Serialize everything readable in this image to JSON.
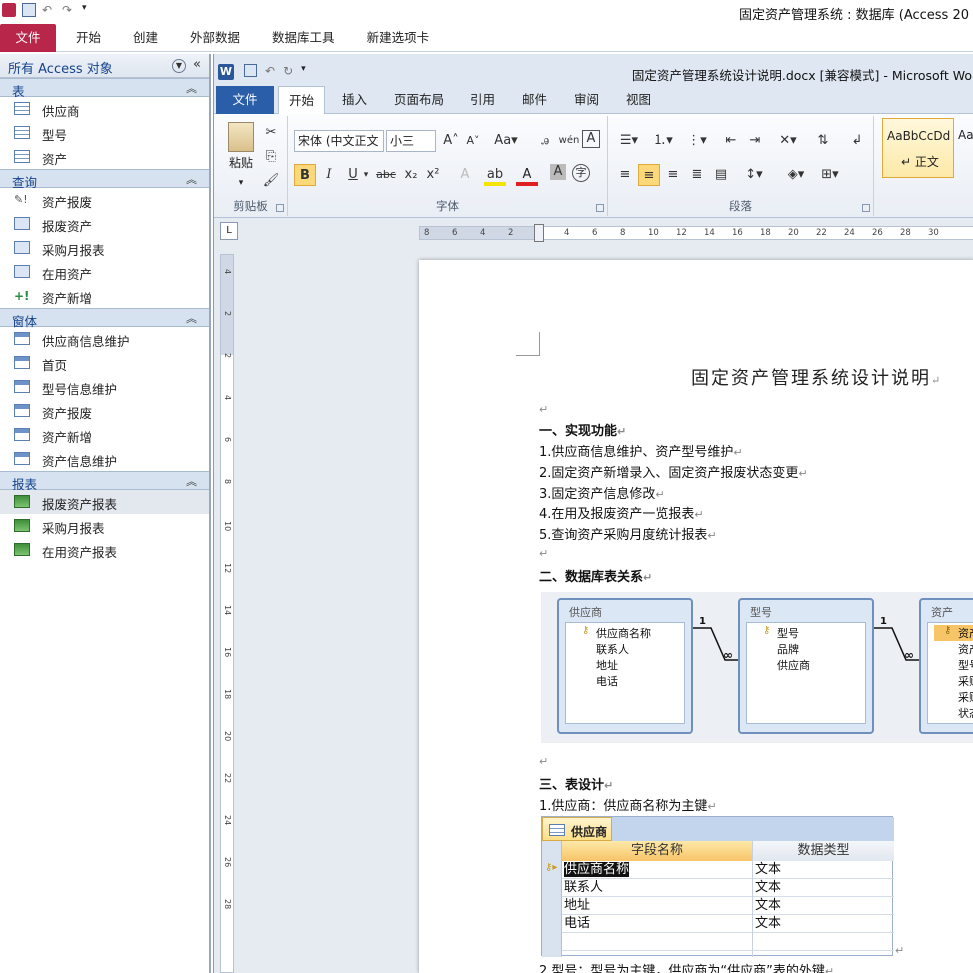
{
  "access": {
    "title": "固定资产管理系统 : 数据库 (Access 20",
    "tabs": [
      "文件",
      "开始",
      "创建",
      "外部数据",
      "数据库工具",
      "新建选项卡"
    ]
  },
  "nav": {
    "header": "所有 Access 对象",
    "groups": [
      {
        "title": "表",
        "items": [
          "供应商",
          "型号",
          "资产"
        ]
      },
      {
        "title": "查询",
        "items": [
          "资产报废",
          "报废资产",
          "采购月报表",
          "在用资产",
          "资产新增"
        ]
      },
      {
        "title": "窗体",
        "items": [
          "供应商信息维护",
          "首页",
          "型号信息维护",
          "资产报废",
          "资产新增",
          "资产信息维护"
        ]
      },
      {
        "title": "报表",
        "items": [
          "报废资产报表",
          "采购月报表",
          "在用资产报表"
        ]
      }
    ]
  },
  "word": {
    "doc_title": "固定资产管理系统设计说明.docx [兼容模式] - Microsoft Wo",
    "tabs": [
      "文件",
      "开始",
      "插入",
      "页面布局",
      "引用",
      "邮件",
      "审阅",
      "视图"
    ],
    "ribbon": {
      "paste_label": "粘贴",
      "font_name": "宋体 (中文正文",
      "font_size": "小三",
      "groups": {
        "clipboard": "剪贴板",
        "font": "字体",
        "paragraph": "段落"
      },
      "style_preview": "AaBbCcDd",
      "style_name": "↵ 正文",
      "style_preview2": "Aa"
    },
    "ruler_ticks": [
      "8",
      "6",
      "4",
      "2",
      "2",
      "4",
      "6",
      "8",
      "10",
      "12",
      "14",
      "16",
      "18",
      "20",
      "22",
      "24",
      "26",
      "28",
      "30"
    ],
    "vruler_ticks": [
      "4",
      "2",
      "2",
      "4",
      "6",
      "8",
      "10",
      "12",
      "14",
      "16",
      "18",
      "20",
      "22",
      "24",
      "26",
      "28"
    ]
  },
  "doc": {
    "title": "固定资产管理系统设计说明",
    "h1": "一、实现功能",
    "items": [
      "1.供应商信息维护、资产型号维护",
      "2.固定资产新增录入、固定资产报废状态变更",
      "3.固定资产信息修改",
      "4.在用及报废资产一览报表",
      "5.查询资产采购月度统计报表"
    ],
    "h2": "二、数据库表关系",
    "relations": {
      "tables": [
        {
          "name": "供应商",
          "fields": [
            "供应商名称",
            "联系人",
            "地址",
            "电话"
          ]
        },
        {
          "name": "型号",
          "fields": [
            "型号",
            "品牌",
            "供应商"
          ]
        },
        {
          "name": "资产",
          "fields": [
            "资产",
            "资产",
            "型号",
            "采购",
            "采购",
            "状态"
          ]
        }
      ],
      "one": "1",
      "many": "∞"
    },
    "h3": "三、表设计",
    "t1_caption": "1.供应商：供应商名称为主键",
    "datasheet": {
      "tab": "供应商",
      "headers": [
        "字段名称",
        "数据类型"
      ],
      "rows": [
        [
          "供应商名称",
          "文本"
        ],
        [
          "联系人",
          "文本"
        ],
        [
          "地址",
          "文本"
        ],
        [
          "电话",
          "文本"
        ]
      ]
    },
    "t2_caption": "2.型号：型号为主键，供应商为“供应商”表的外键"
  }
}
